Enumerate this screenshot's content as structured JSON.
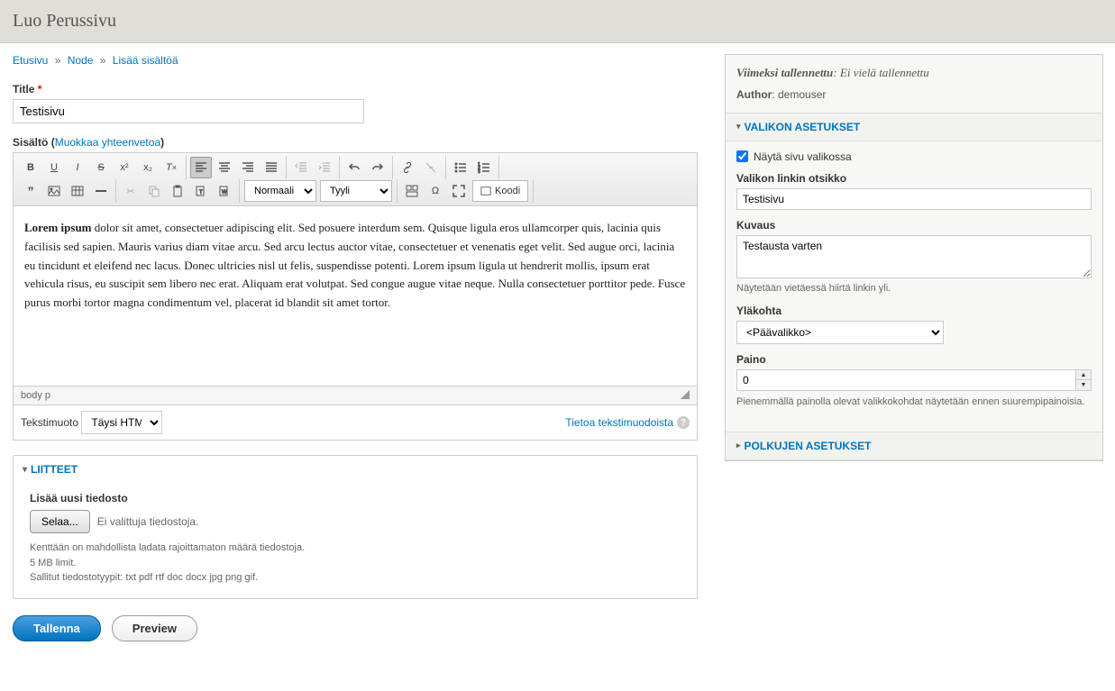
{
  "page_title": "Luo Perussivu",
  "breadcrumb": {
    "items": [
      "Etusivu",
      "Node",
      "Lisää sisältöä"
    ]
  },
  "title_field": {
    "label": "Title",
    "value": "Testisivu"
  },
  "content_field": {
    "label": "Sisältö",
    "summary_link": "Muokkaa yhteenvetoa",
    "body_html": "<strong>Lorem ipsum</strong> dolor sit amet, consectetuer adipiscing elit. Sed posuere interdum sem. Quisque ligula eros ullamcorper quis, lacinia quis facilisis sed sapien. Mauris varius diam vitae arcu. Sed arcu lectus auctor vitae, consectetuer et venenatis eget velit. Sed augue orci, lacinia eu tincidunt et eleifend nec lacus. Donec ultricies nisl ut felis, suspendisse potenti. Lorem ipsum ligula ut hendrerit mollis, ipsum erat vehicula risus, eu suscipit sem libero nec erat. Aliquam erat volutpat. Sed congue augue vitae neque. Nulla consectetuer porttitor pede. Fusce purus morbi tortor magna condimentum vel, placerat id blandit sit amet tortor.",
    "status_path": "body  p",
    "format_select": "Normaali",
    "style_select": "Tyyli",
    "code_btn": "Koodi"
  },
  "format_row": {
    "label": "Tekstimuoto",
    "selected": "Täysi HTML",
    "info_link": "Tietoa tekstimuodoista"
  },
  "attachments": {
    "title": "LIITTEET",
    "add_label": "Lisää uusi tiedosto",
    "browse_btn": "Selaa...",
    "no_file": "Ei valittuja tiedostoja.",
    "help1": "Kenttään on mahdollista ladata rajoittamaton määrä tiedostoja.",
    "help2": "5 MB limit.",
    "help3": "Sallitut tiedostotyypit: txt pdf rtf doc docx jpg png gif."
  },
  "actions": {
    "save": "Tallenna",
    "preview": "Preview"
  },
  "sidebar": {
    "saved_label": "Viimeksi tallennettu",
    "saved_value": "Ei vielä tallennettu",
    "author_label": "Author",
    "author_value": "demouser",
    "menu_settings": {
      "title": "VALIKON ASETUKSET",
      "show_checkbox": "Näytä sivu valikossa",
      "link_title_label": "Valikon linkin otsikko",
      "link_title_value": "Testisivu",
      "desc_label": "Kuvaus",
      "desc_value": "Testausta varten",
      "desc_help": "Näytetään vietäessä hiirtä linkin yli.",
      "parent_label": "Yläkohta",
      "parent_value": "<Päävalikko>",
      "weight_label": "Paino",
      "weight_value": "0",
      "weight_help": "Pienemmällä painolla olevat valikkokohdat näytetään ennen suurempipainoisia."
    },
    "path_settings": {
      "title": "POLKUJEN ASETUKSET"
    }
  }
}
